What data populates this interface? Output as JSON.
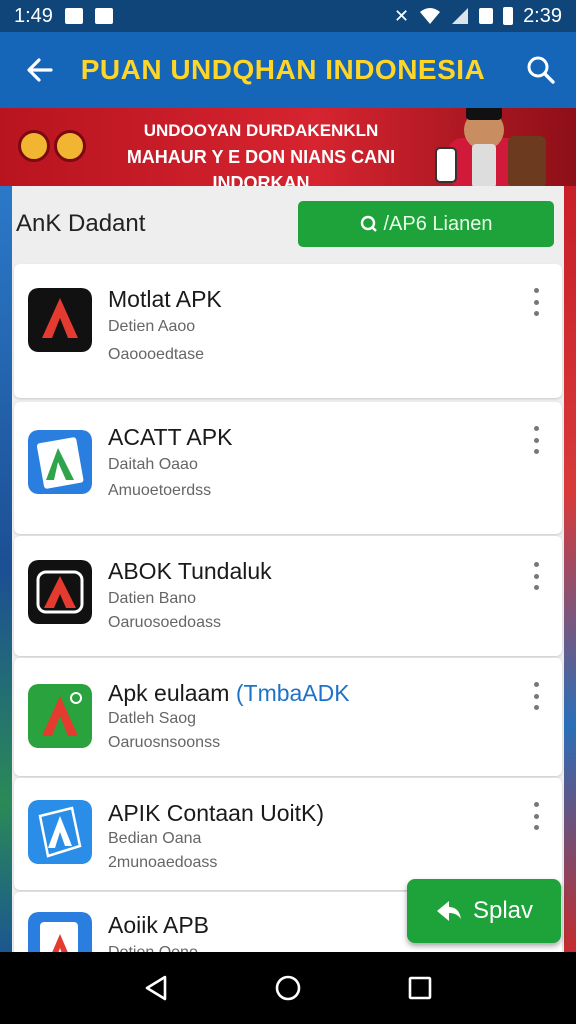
{
  "status_bar": {
    "time_left": "1:49",
    "time_right": "2:39"
  },
  "app_bar": {
    "title": "PUAN UNDQHAN INDONESIA"
  },
  "banner": {
    "line1": "UNDOOYAN DURDAKENKLN",
    "line2": "MAHAUR Y E DON NIANS CANI INDORKAN"
  },
  "panel": {
    "title": "AnK Dadant",
    "action_label": "/AP6 Lianen"
  },
  "apps": [
    {
      "name": "Motlat APK",
      "sub1": "Detien Aaoo",
      "sub2": "Oaoooedtase",
      "icon": "apk-icon-black-red",
      "bg": "#111111",
      "fg": "#e43a2f"
    },
    {
      "name": "ACATT APK",
      "sub1": "Daitah Oaao",
      "sub2": "Amuoetoerdss",
      "icon": "apk-icon-blue-green",
      "bg": "#2a7ee0",
      "fg": "#2fa44a"
    },
    {
      "name": "ABOK Tundaluk",
      "sub1": "Datien Bano",
      "sub2": "Oaruosoedoass",
      "icon": "apk-icon-black-outline",
      "bg": "#111111",
      "fg": "#e43a2f"
    },
    {
      "name": "Apk eulaam ",
      "name_highlight": "(TmbaADK",
      "sub1": "Datleh Saog",
      "sub2": "Oaruosnsoonss",
      "icon": "apk-icon-green-red",
      "bg": "#2aa23d",
      "fg": "#e43a2f"
    },
    {
      "name": "APIK Contaan UoitK)",
      "sub1": "Bedian Oana",
      "sub2": "2munoaedoass",
      "icon": "apk-icon-blue-white",
      "bg": "#2a8ee8",
      "fg": "#ffffff"
    },
    {
      "name": "Aoiik APB",
      "sub1": "Dotien Oono",
      "sub2": "",
      "icon": "apk-icon-blue-red",
      "bg": "#2a7ee0",
      "fg": "#e43a2f"
    }
  ],
  "fab": {
    "label": "Splav"
  },
  "colors": {
    "primary": "#1565b8",
    "accent_green": "#1ea23a",
    "title_yellow": "#ffd628"
  }
}
